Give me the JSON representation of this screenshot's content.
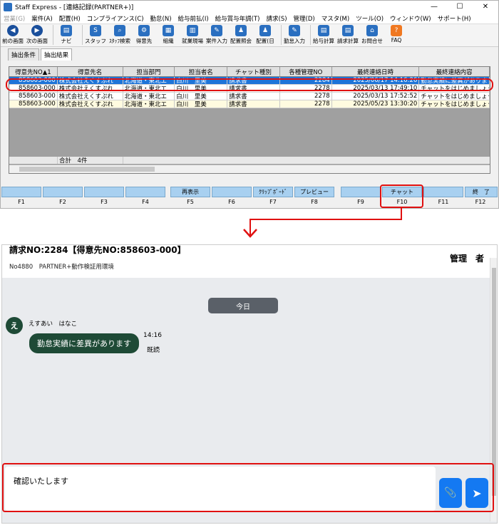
{
  "window": {
    "title": "Staff Express - [連絡記録(PARTNER+)]",
    "minimize": "—",
    "maximize": "☐",
    "close": "✕"
  },
  "menu": [
    {
      "label": "営業(G)",
      "dim": true
    },
    {
      "label": "案件(A)"
    },
    {
      "label": "配置(H)"
    },
    {
      "label": "コンプライアンス(C)"
    },
    {
      "label": "勤怠(N)"
    },
    {
      "label": "給与前払(I)"
    },
    {
      "label": "給与賞与年調(T)"
    },
    {
      "label": "請求(S)"
    },
    {
      "label": "管理(D)"
    },
    {
      "label": "マスタ(M)"
    },
    {
      "label": "ツール(O)"
    },
    {
      "label": "ウィンドウ(W)"
    },
    {
      "label": "サポート(H)"
    }
  ],
  "toolbar": {
    "prev": "前の画面",
    "next": "次の画面",
    "navi": "ナビ",
    "staff": "スタッフ",
    "staff_search": "ｽﾀｯﾌ検索",
    "client": "得意先",
    "org": "組織",
    "site": "就業現場",
    "case_input": "案件入力",
    "assign_view": "配置照会",
    "assign": "配置(日",
    "attendance": "勤怠入力",
    "payroll": "給与計算",
    "billing": "請求計算",
    "contact": "お問合せ",
    "faq": "FAQ"
  },
  "tabs": [
    "抽出条件",
    "抽出結果"
  ],
  "grid": {
    "headers": [
      "得意先NO▲1",
      "得意先名",
      "担当部門",
      "担当者名",
      "チャット種別",
      "各種管理NO",
      "最終連絡日時",
      "最終連絡内容"
    ],
    "rows": [
      [
        "858603-000",
        "株式会社えくすぷれ",
        "北海道・東北エ",
        "白川　里美",
        "請求書",
        "2284",
        "2025/06/17 14:16:26",
        "勤怠実績に差異があります"
      ],
      [
        "858603-000",
        "株式会社えくすぷれ",
        "北海道・東北エ",
        "白川　里美",
        "請求書",
        "2278",
        "2025/03/13 17:49:10",
        "チャットをはじめましょう"
      ],
      [
        "858603-000",
        "株式会社えくすぷれ",
        "北海道・東北エ",
        "白川　里美",
        "請求書",
        "2278",
        "2025/03/13 17:52:52",
        "チャットをはじめましょう"
      ],
      [
        "858603-000",
        "株式会社えくすぷれ",
        "北海道・東北エ",
        "白川　里美",
        "請求書",
        "2278",
        "2025/05/23 13:30:20",
        "チャットをはじめましょう"
      ]
    ],
    "total": "合計　4件"
  },
  "fkeys": [
    {
      "label": "",
      "key": "F1"
    },
    {
      "label": "",
      "key": "F2"
    },
    {
      "label": "",
      "key": "F3"
    },
    {
      "label": "",
      "key": "F4"
    },
    {
      "label": "再表示",
      "key": "F5"
    },
    {
      "label": "",
      "key": "F6"
    },
    {
      "label": "ｸﾘｯﾌﾟﾎﾞｰﾄﾞ",
      "key": "F7"
    },
    {
      "label": "プレビュー",
      "key": "F8"
    },
    {
      "label": "",
      "key": "F9"
    },
    {
      "label": "チャット",
      "key": "F10"
    },
    {
      "label": "",
      "key": "F11"
    },
    {
      "label": "終　了",
      "key": "F12"
    }
  ],
  "chat": {
    "title": "請求NO:2284【得意先NO:858603-000】",
    "subtitle": "No4880　PARTNER+動作検証用環境",
    "user": "管理　者",
    "date_label": "今日",
    "avatar": "え",
    "sender": "えすあい　はなこ",
    "message": "勤怠実績に差異があります",
    "time": "14:16",
    "read": "既読",
    "input_value": "確認いたします",
    "attach_icon": "📎",
    "send_icon": "➤"
  },
  "colors": {
    "selected_row": "#1e74d8",
    "fkey": "#a8d0f0",
    "highlight": "#e01010",
    "bubble": "#1e4a36",
    "send_button": "#1479f2"
  }
}
